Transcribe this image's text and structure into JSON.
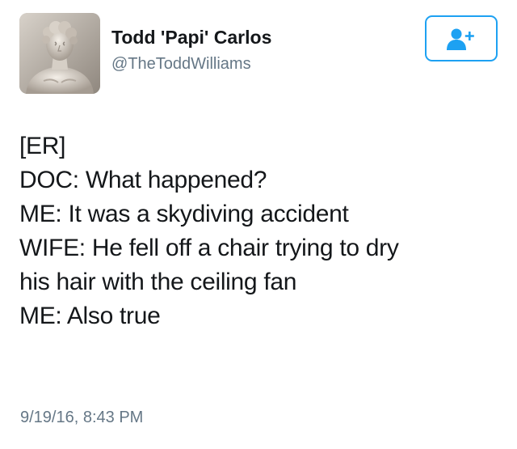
{
  "user": {
    "display_name": "Todd 'Papi' Carlos",
    "handle": "@TheToddWilliams",
    "avatar_icon": "statue-bust-avatar"
  },
  "follow_button": {
    "icon": "add-user-icon",
    "color": "#1da1f2"
  },
  "tweet": {
    "lines": [
      "[ER]",
      "DOC: What happened?",
      "ME: It was a skydiving accident",
      "WIFE: He fell off a chair trying to dry",
      "his hair with the ceiling fan",
      "ME: Also true"
    ],
    "timestamp": "9/19/16, 8:43 PM"
  },
  "colors": {
    "text": "#14171a",
    "secondary": "#657786",
    "accent": "#1da1f2"
  }
}
